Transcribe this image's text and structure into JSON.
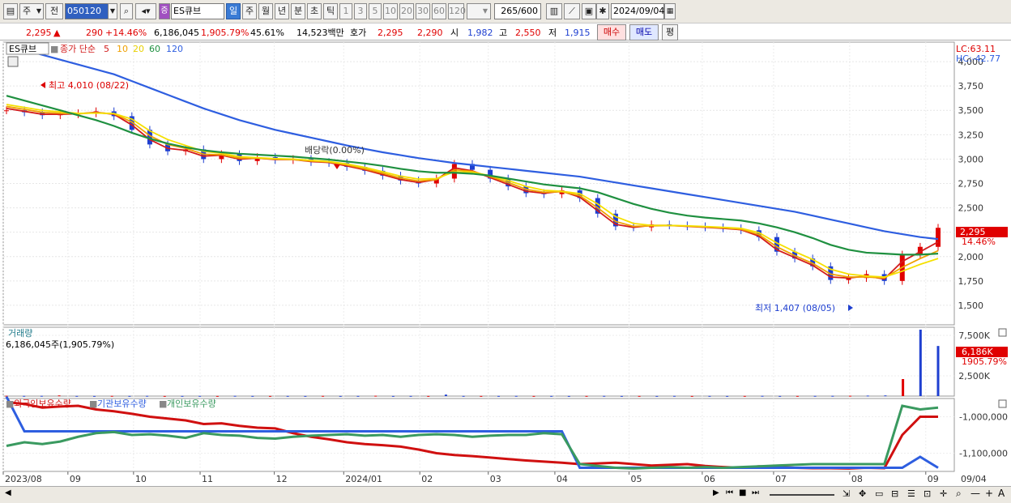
{
  "toolbar": {
    "period_label": "주",
    "prev_label": "전",
    "code": "050120",
    "stock_badge": "증",
    "stock_name": "ES큐브",
    "timeframes": [
      "일",
      "주",
      "월",
      "년",
      "분",
      "초",
      "틱"
    ],
    "intervals": [
      "1",
      "3",
      "5",
      "10",
      "20",
      "30",
      "60",
      "120"
    ],
    "count": "265",
    "count_total": "/600",
    "date": "2024/09/04"
  },
  "info": {
    "price": "2,295",
    "price_arrow": "▲",
    "change": "290",
    "change_pct": "+14.46%",
    "volume": "6,186,045",
    "volume_pct": "1,905.79%",
    "turnover_pct": "45.61%",
    "amount": "14,523백만",
    "ask_label": "호가",
    "ask": "2,295",
    "bid": "2,290",
    "open_label": "시",
    "open": "1,982",
    "high_label": "고",
    "high": "2,550",
    "low_label": "저",
    "low": "1,915",
    "buy_label": "매수",
    "sell_label": "매도",
    "eval_label": "평"
  },
  "colors": {
    "up": "#e00000",
    "down": "#1e3fd0",
    "ma5": "#d21c1c",
    "ma10": "#f0a000",
    "ma20": "#f5e000",
    "ma60": "#1f9040",
    "ma120": "#2e5ee0",
    "foreign": "#d01010",
    "inst": "#2e5ee0",
    "indiv": "#3a9a60"
  },
  "price_panel": {
    "name_box": "ES큐브",
    "legend_title": "종가 단순",
    "legend_periods": [
      "5",
      "10",
      "20",
      "60",
      "120"
    ],
    "annotation_high": "최고 4,010 (08/22)",
    "annotation_low": "최저 1,407 (08/05)",
    "annotation_div": "배당락(0.00%)",
    "lc_label": "LC:63.11",
    "hc_label": "HC:-42.77",
    "last_price": "2,295",
    "last_pct": "14.46%",
    "y_ticks": [
      "4,000",
      "3,750",
      "3,500",
      "3,250",
      "3,000",
      "2,750",
      "2,500",
      "2,250",
      "2,000",
      "1,750",
      "1,500"
    ]
  },
  "volume_panel": {
    "title": "거래량",
    "value_text": "6,186,045주(1,905.79%)",
    "y_ticks": [
      "7,500K",
      "2,500K"
    ],
    "last_label": "6,186K",
    "last_pct": "1905.79%"
  },
  "holding_panel": {
    "legend": [
      "외국인보유수량",
      "기관보유수량",
      "개인보유수량"
    ],
    "y_ticks": [
      "-1,000,000",
      "-1,100,000"
    ]
  },
  "x_axis": [
    "2023/08",
    "09",
    "10",
    "11",
    "12",
    "2024/01",
    "02",
    "03",
    "04",
    "05",
    "06",
    "07",
    "08",
    "09"
  ],
  "x_axis_right": "09/04",
  "chart_data": [
    {
      "type": "line",
      "title": "ES큐브",
      "ylim": [
        1300,
        4200
      ],
      "y_ticks": [
        4000,
        3750,
        3500,
        3250,
        3000,
        2750,
        2500,
        2250,
        2000,
        1750,
        1500
      ],
      "series": [
        {
          "name": "close",
          "values": [
            3500,
            3480,
            3450,
            3460,
            3470,
            3490,
            3440,
            3300,
            3150,
            3080,
            3100,
            3000,
            3050,
            2980,
            3020,
            2990,
            3000,
            2970,
            2960,
            2920,
            2880,
            2830,
            2780,
            2750,
            2800,
            2950,
            2890,
            2800,
            2720,
            2650,
            2640,
            2680,
            2600,
            2440,
            2310,
            2300,
            2330,
            2320,
            2310,
            2300,
            2290,
            2270,
            2200,
            2050,
            1980,
            1900,
            1760,
            1780,
            1820,
            1750,
            2020,
            2100,
            2295
          ]
        },
        {
          "name": "5",
          "values": [
            3520,
            3490,
            3460,
            3460,
            3465,
            3480,
            3460,
            3350,
            3200,
            3110,
            3090,
            3030,
            3040,
            3000,
            3010,
            2995,
            2995,
            2975,
            2965,
            2930,
            2890,
            2840,
            2790,
            2760,
            2790,
            2910,
            2880,
            2810,
            2740,
            2670,
            2650,
            2670,
            2610,
            2470,
            2330,
            2300,
            2320,
            2320,
            2310,
            2300,
            2290,
            2275,
            2210,
            2070,
            1990,
            1910,
            1790,
            1780,
            1800,
            1770,
            1950,
            2050,
            2150
          ]
        },
        {
          "name": "10",
          "values": [
            3540,
            3510,
            3480,
            3470,
            3465,
            3475,
            3465,
            3380,
            3240,
            3150,
            3110,
            3050,
            3045,
            3010,
            3010,
            3000,
            2995,
            2980,
            2970,
            2940,
            2900,
            2855,
            2805,
            2775,
            2790,
            2890,
            2875,
            2820,
            2760,
            2690,
            2660,
            2665,
            2625,
            2500,
            2360,
            2310,
            2315,
            2318,
            2312,
            2305,
            2295,
            2280,
            2225,
            2100,
            2010,
            1930,
            1820,
            1790,
            1790,
            1780,
            1890,
            1980,
            2060
          ]
        },
        {
          "name": "20",
          "values": [
            3560,
            3530,
            3500,
            3485,
            3470,
            3472,
            3468,
            3410,
            3290,
            3200,
            3140,
            3080,
            3060,
            3025,
            3015,
            3005,
            3000,
            2988,
            2975,
            2950,
            2915,
            2870,
            2825,
            2795,
            2800,
            2870,
            2865,
            2830,
            2780,
            2720,
            2680,
            2670,
            2645,
            2540,
            2410,
            2340,
            2320,
            2320,
            2316,
            2308,
            2300,
            2290,
            2245,
            2140,
            2050,
            1970,
            1870,
            1820,
            1800,
            1790,
            1850,
            1920,
            1980
          ]
        },
        {
          "name": "60",
          "values": [
            3650,
            3600,
            3550,
            3500,
            3450,
            3400,
            3340,
            3270,
            3210,
            3160,
            3120,
            3090,
            3070,
            3055,
            3045,
            3035,
            3025,
            3010,
            2995,
            2975,
            2955,
            2930,
            2900,
            2875,
            2860,
            2860,
            2850,
            2830,
            2800,
            2770,
            2740,
            2720,
            2700,
            2660,
            2600,
            2540,
            2490,
            2450,
            2420,
            2400,
            2385,
            2370,
            2340,
            2300,
            2250,
            2190,
            2120,
            2070,
            2040,
            2030,
            2020,
            2020,
            2030
          ]
        },
        {
          "name": "120",
          "values": [
            4170,
            4120,
            4070,
            4020,
            3970,
            3920,
            3870,
            3800,
            3730,
            3660,
            3590,
            3520,
            3460,
            3400,
            3350,
            3300,
            3260,
            3220,
            3180,
            3140,
            3105,
            3070,
            3040,
            3010,
            2985,
            2960,
            2940,
            2920,
            2900,
            2880,
            2860,
            2840,
            2820,
            2790,
            2760,
            2730,
            2700,
            2670,
            2640,
            2610,
            2580,
            2550,
            2520,
            2490,
            2460,
            2420,
            2380,
            2340,
            2300,
            2260,
            2230,
            2200,
            2180
          ]
        }
      ]
    },
    {
      "type": "bar",
      "title": "거래량",
      "ylim": [
        0,
        8500
      ],
      "unit": "K",
      "values": [
        40,
        25,
        30,
        80,
        20,
        15,
        25,
        20,
        30,
        15,
        20,
        25,
        15,
        30,
        20,
        15,
        20,
        15,
        25,
        15,
        20,
        40,
        15,
        20,
        15,
        180,
        20,
        15,
        20,
        25,
        15,
        20,
        15,
        20,
        25,
        15,
        20,
        15,
        25,
        15,
        20,
        15,
        20,
        30,
        15,
        20,
        25,
        30,
        40,
        60,
        80,
        2100,
        8200,
        6186
      ]
    },
    {
      "type": "line",
      "title": "보유수량",
      "ylim": [
        -1150000,
        -950000
      ],
      "series": [
        {
          "name": "외국인보유수량",
          "values": [
            -960000,
            -965000,
            -975000,
            -972000,
            -970000,
            -980000,
            -985000,
            -992000,
            -1000000,
            -1005000,
            -1010000,
            -1020000,
            -1018000,
            -1025000,
            -1030000,
            -1032000,
            -1045000,
            -1055000,
            -1062000,
            -1070000,
            -1075000,
            -1078000,
            -1082000,
            -1090000,
            -1100000,
            -1105000,
            -1108000,
            -1112000,
            -1116000,
            -1120000,
            -1123000,
            -1126000,
            -1130000,
            -1128000,
            -1126000,
            -1130000,
            -1134000,
            -1132000,
            -1130000,
            -1135000,
            -1138000,
            -1140000,
            -1136000,
            -1138000,
            -1140000,
            -1141000,
            -1141000,
            -1142000,
            -1140000,
            -1141000,
            -1050000,
            -1000000,
            -1000000
          ]
        },
        {
          "name": "기관보유수량",
          "values": [
            -945000,
            -1040000,
            -1040000,
            -1040000,
            -1040000,
            -1040000,
            -1040000,
            -1040000,
            -1040000,
            -1040000,
            -1040000,
            -1040000,
            -1040000,
            -1040000,
            -1040000,
            -1040000,
            -1040000,
            -1040000,
            -1040000,
            -1040000,
            -1040000,
            -1040000,
            -1040000,
            -1040000,
            -1040000,
            -1040000,
            -1040000,
            -1040000,
            -1040000,
            -1040000,
            -1040000,
            -1040000,
            -1140000,
            -1140000,
            -1140000,
            -1140000,
            -1140000,
            -1140000,
            -1140000,
            -1140000,
            -1140000,
            -1140000,
            -1140000,
            -1140000,
            -1140000,
            -1140000,
            -1140000,
            -1140000,
            -1140000,
            -1140000,
            -1140000,
            -1110000,
            -1140000
          ]
        },
        {
          "name": "개인보유수량",
          "values": [
            -1080000,
            -1070000,
            -1075000,
            -1068000,
            -1055000,
            -1045000,
            -1042000,
            -1050000,
            -1048000,
            -1052000,
            -1058000,
            -1045000,
            -1050000,
            -1052000,
            -1058000,
            -1060000,
            -1055000,
            -1052000,
            -1050000,
            -1048000,
            -1052000,
            -1050000,
            -1055000,
            -1050000,
            -1048000,
            -1050000,
            -1055000,
            -1052000,
            -1050000,
            -1050000,
            -1045000,
            -1048000,
            -1130000,
            -1135000,
            -1140000,
            -1142000,
            -1140000,
            -1138000,
            -1140000,
            -1138000,
            -1140000,
            -1138000,
            -1136000,
            -1134000,
            -1132000,
            -1130000,
            -1130000,
            -1130000,
            -1130000,
            -1130000,
            -970000,
            -980000,
            -975000
          ]
        }
      ]
    }
  ]
}
